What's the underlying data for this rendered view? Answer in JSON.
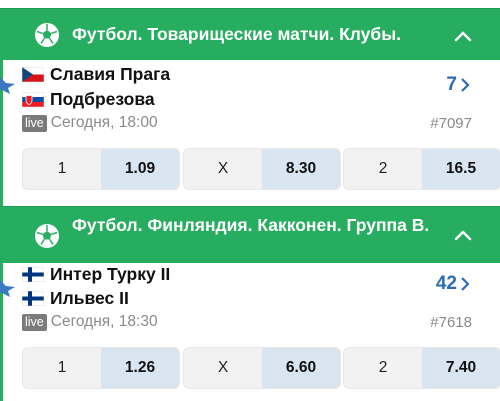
{
  "matches": [
    {
      "league": "Футбол. Товарищеские матчи. Клубы.",
      "team1": "Славия Прага",
      "team2": "Подбрезова",
      "live": "live",
      "time": "Сегодня, 18:00",
      "more_count": "7",
      "id": "#7097",
      "odds": [
        {
          "label": "1",
          "value": "1.09"
        },
        {
          "label": "X",
          "value": "8.30"
        },
        {
          "label": "2",
          "value": "16.5"
        }
      ]
    },
    {
      "league": "Футбол. Финляндия. Какконен. Группа B.",
      "team1": "Интер Турку II",
      "team2": "Ильвес II",
      "live": "live",
      "time": "Сегодня, 18:30",
      "more_count": "42",
      "id": "#7618",
      "odds": [
        {
          "label": "1",
          "value": "1.26"
        },
        {
          "label": "X",
          "value": "6.60"
        },
        {
          "label": "2",
          "value": "7.40"
        }
      ]
    }
  ],
  "colors": {
    "header_green": "#27ad60",
    "link_blue": "#2b6cb3",
    "odds_value_bg": "#d9e6f2"
  },
  "icons": [
    "soccer-ball-icon",
    "chevron-up-icon",
    "favorite-star-icon",
    "chevron-right-icon"
  ]
}
